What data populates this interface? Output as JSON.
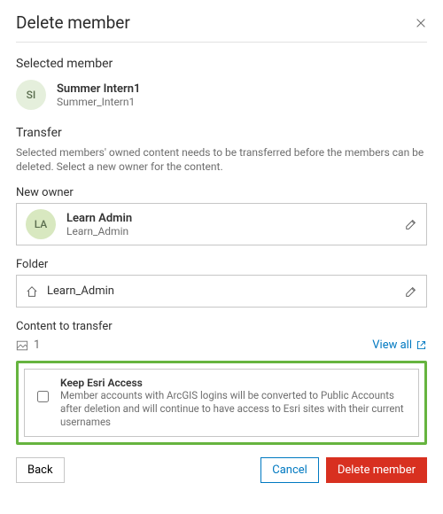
{
  "dialog": {
    "title": "Delete member"
  },
  "selected": {
    "label": "Selected member",
    "avatar_initials": "SI",
    "name": "Summer Intern1",
    "username": "Summer_Intern1"
  },
  "transfer": {
    "label": "Transfer",
    "description": "Selected members' owned content needs to be transferred before the members can be deleted. Select a new owner for the content.",
    "new_owner_label": "New owner",
    "owner": {
      "avatar_initials": "LA",
      "name": "Learn Admin",
      "username": "Learn_Admin"
    },
    "folder_label": "Folder",
    "folder_name": "Learn_Admin",
    "content_label": "Content to transfer",
    "content_count": "1",
    "view_all_label": "View all"
  },
  "keep_access": {
    "title": "Keep Esri Access",
    "description": "Member accounts with ArcGIS logins will be converted to Public Accounts after deletion and will continue to have access to Esri sites with their current usernames"
  },
  "buttons": {
    "back": "Back",
    "cancel": "Cancel",
    "delete": "Delete member"
  }
}
